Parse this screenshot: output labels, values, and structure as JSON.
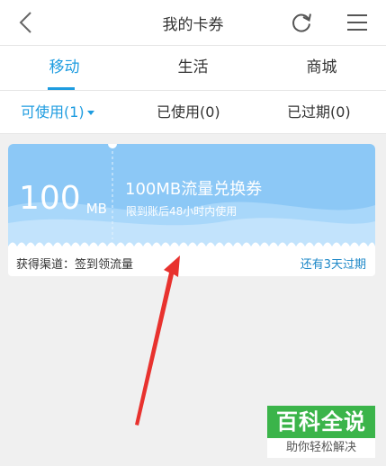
{
  "header": {
    "title": "我的卡券",
    "back_icon": "back-chevron-icon",
    "refresh_icon": "refresh-icon",
    "menu_icon": "hamburger-menu-icon"
  },
  "tabs": [
    {
      "label": "移动",
      "active": true
    },
    {
      "label": "生活",
      "active": false
    },
    {
      "label": "商城",
      "active": false
    }
  ],
  "filters": [
    {
      "label": "可使用(1)",
      "active": true
    },
    {
      "label": "已使用(0)",
      "active": false
    },
    {
      "label": "已过期(0)",
      "active": false
    }
  ],
  "coupon": {
    "amount": "100",
    "unit": "MB",
    "name": "100MB流量兑换券",
    "description": "限到账后48小时内使用",
    "channel": "获得渠道：签到领流量",
    "expiry": "还有3天过期"
  },
  "watermark": {
    "title": "百科全说",
    "subtitle": "助你轻松解决"
  },
  "colors": {
    "accent": "#1e9ce0",
    "coupon_bg": "#8cc8f6",
    "arrow": "#e8322e",
    "watermark_green": "#3bb44a"
  }
}
